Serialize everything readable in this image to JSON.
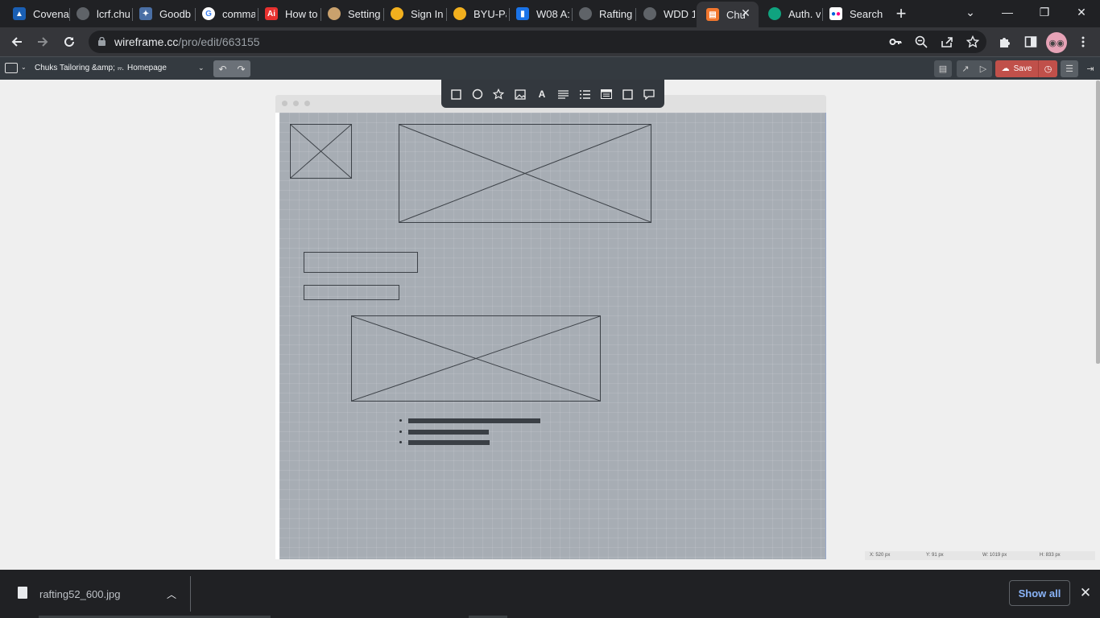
{
  "browser": {
    "tabs": [
      {
        "title": "Covena",
        "icon": "blue-badge-icon",
        "color": "#1a73e8"
      },
      {
        "title": "lcrf.chu",
        "icon": "globe-icon",
        "color": "#5f6368"
      },
      {
        "title": "Goodb",
        "icon": "bird-icon",
        "color": "#4a6fa5"
      },
      {
        "title": "comma",
        "icon": "google-icon",
        "color": "#ffffff"
      },
      {
        "title": "How to",
        "icon": "adobe-icon",
        "color": "#e8312f"
      },
      {
        "title": "Setting",
        "icon": "crest-icon",
        "color": "#c9a16d"
      },
      {
        "title": "Sign In",
        "icon": "byu-pathway-icon",
        "color": "#f2b01e"
      },
      {
        "title": "BYU-Pa",
        "icon": "byu-pathway-icon",
        "color": "#f2b01e"
      },
      {
        "title": "W08 A:",
        "icon": "canvas-icon",
        "color": "#1a73e8"
      },
      {
        "title": "Rafting",
        "icon": "globe-icon",
        "color": "#5f6368"
      },
      {
        "title": "WDD 1",
        "icon": "globe-icon",
        "color": "#5f6368"
      },
      {
        "title": "Chu",
        "icon": "wireframe-icon",
        "color": "#f2772e",
        "active": true
      },
      {
        "title": "Auth. v",
        "icon": "openai-icon",
        "color": "#10a37f"
      },
      {
        "title": "Search",
        "icon": "flickr-icon",
        "color": "#ffffff"
      }
    ],
    "url_host": "wireframe.cc",
    "url_path": "/pro/edit/663155"
  },
  "app": {
    "project_title": "Chuks Tailoring &amp; ...",
    "separator": "–",
    "page_name": "Homepage",
    "save_label": "Save"
  },
  "metrics": {
    "x": "X: 520 px",
    "y": "Y: 91 px",
    "w": "W: 1019 px",
    "h": "H: 833 px"
  },
  "downloads": {
    "file_name": "rafting52_600.jpg",
    "show_all_label": "Show all"
  },
  "colors": {
    "tab_bar": "#202124",
    "toolbar": "#35363a",
    "app_bar": "#343a40",
    "canvas": "#a7adb4",
    "save_button": "#c0504a",
    "link_blue": "#8ab4f8"
  }
}
